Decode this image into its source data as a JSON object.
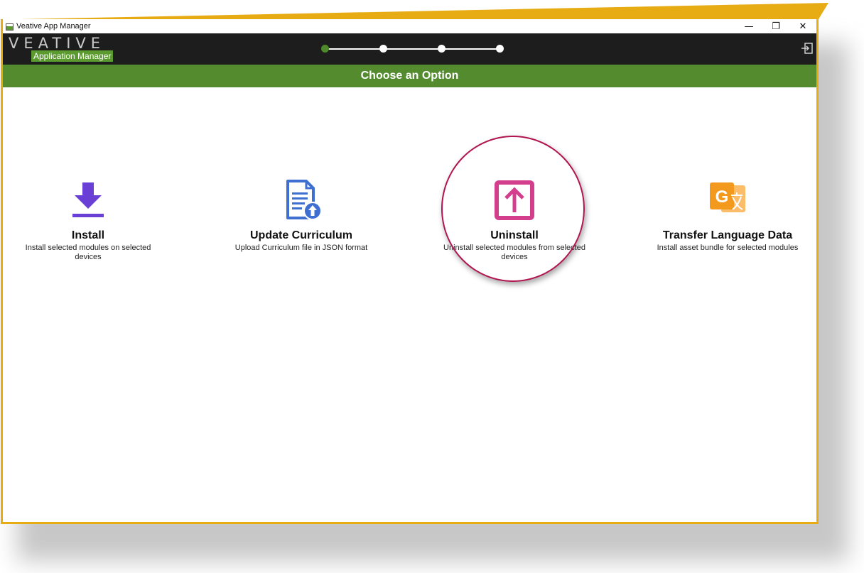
{
  "window": {
    "title": "Veative App Manager",
    "minimize_symbol": "—",
    "restore_symbol": "❐",
    "close_symbol": "✕"
  },
  "header": {
    "logo_text": "VEATIVE",
    "logo_subtitle": "Application Manager",
    "steps_total": 4,
    "steps_current": 1,
    "exit_icon": "exit-icon"
  },
  "banner": {
    "title": "Choose an Option"
  },
  "options": [
    {
      "label": "Install",
      "description": "Install selected modules on selected devices",
      "icon": "download-icon",
      "color": "#6a3fd6"
    },
    {
      "label": "Update Curriculum",
      "description": "Upload Curriculum file in JSON format",
      "icon": "document-upload-icon",
      "color": "#3f6fd1"
    },
    {
      "label": "Uninstall",
      "description": "Uninstall selected modules from selected devices",
      "icon": "uninstall-box-arrow-icon",
      "color": "#d43f8d"
    },
    {
      "label": "Transfer Language Data",
      "description": "Install asset bundle for selected modules",
      "icon": "translate-icon",
      "color": "#f39a1e"
    }
  ],
  "colors": {
    "frame": "#e7ab13",
    "header_bg": "#1d1d1d",
    "banner_bg": "#558b2f",
    "highlight_ring": "#b0154f"
  }
}
